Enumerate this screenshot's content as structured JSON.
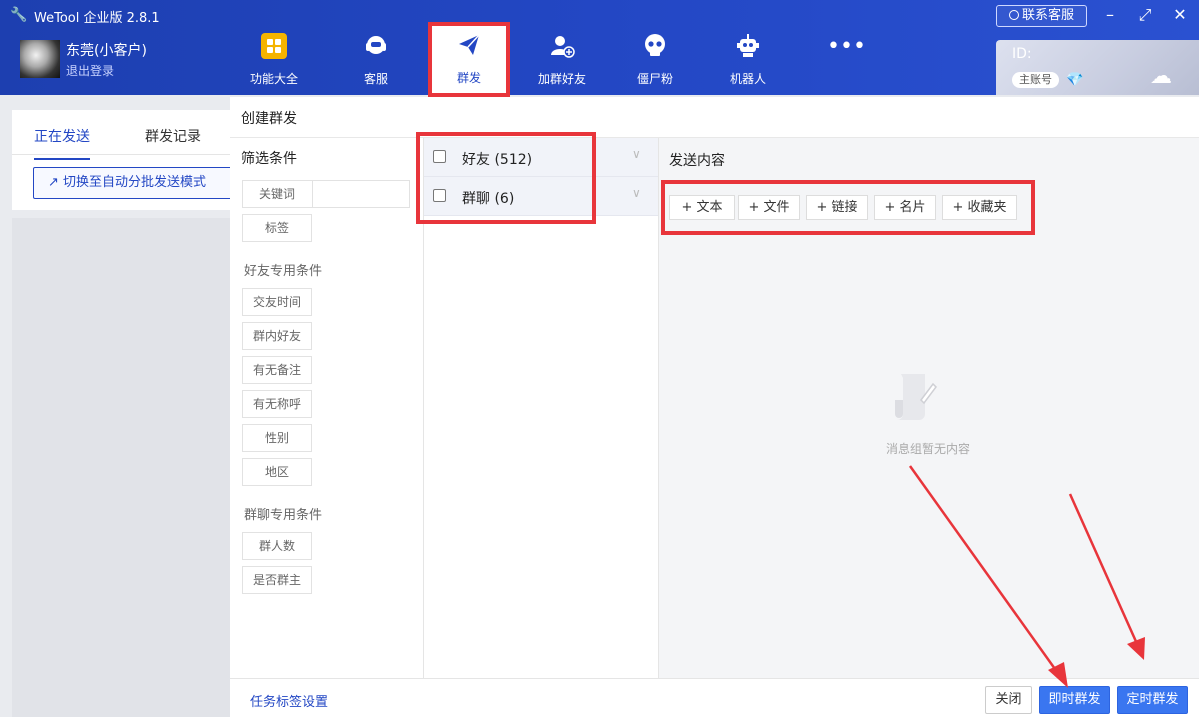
{
  "app": {
    "title": "WeTool 企业版 2.8.1",
    "support_label": "联系客服"
  },
  "user": {
    "name": "东莞(小客户)",
    "logout_label": "退出登录"
  },
  "nav": [
    {
      "label": "功能大全",
      "icon": "grid-icon"
    },
    {
      "label": "客服",
      "icon": "headset-icon"
    },
    {
      "label": "群发",
      "icon": "paper-plane-icon",
      "active": true
    },
    {
      "label": "加群好友",
      "icon": "add-user-icon"
    },
    {
      "label": "僵尸粉",
      "icon": "skull-icon"
    },
    {
      "label": "机器人",
      "icon": "robot-icon"
    },
    {
      "label": "",
      "icon": "more-icon"
    }
  ],
  "account": {
    "id_label": "ID:",
    "badge": "主账号"
  },
  "background": {
    "tabs": [
      "正在发送",
      "群发记录"
    ],
    "mode_button": "切换至自动分批发送模式"
  },
  "dialog": {
    "title": "创建群发",
    "filter_title": "筛选条件",
    "general_filters": [
      "关键词",
      "标签"
    ],
    "friend_section": "好友专用条件",
    "friend_filters": [
      "交友时间",
      "群内好友",
      "有无备注",
      "有无称呼",
      "性别",
      "地区"
    ],
    "group_section": "群聊专用条件",
    "group_filters": [
      "群人数",
      "是否群主"
    ],
    "targets": [
      {
        "label": "好友",
        "count": "(512)"
      },
      {
        "label": "群聊",
        "count": "(6)"
      }
    ],
    "content_title": "发送内容",
    "add_buttons": [
      "+ 文本",
      "+ 文件",
      "+ 链接",
      "+ 名片",
      "+ 收藏夹"
    ],
    "empty_text": "消息组暂无内容",
    "footer": {
      "tag_link": "任务标签设置",
      "close": "关闭",
      "send_now": "即时群发",
      "send_scheduled": "定时群发"
    }
  },
  "colors": {
    "brand": "#2347c4",
    "annotation": "#e8353b",
    "primary_button": "#3a76f0"
  }
}
